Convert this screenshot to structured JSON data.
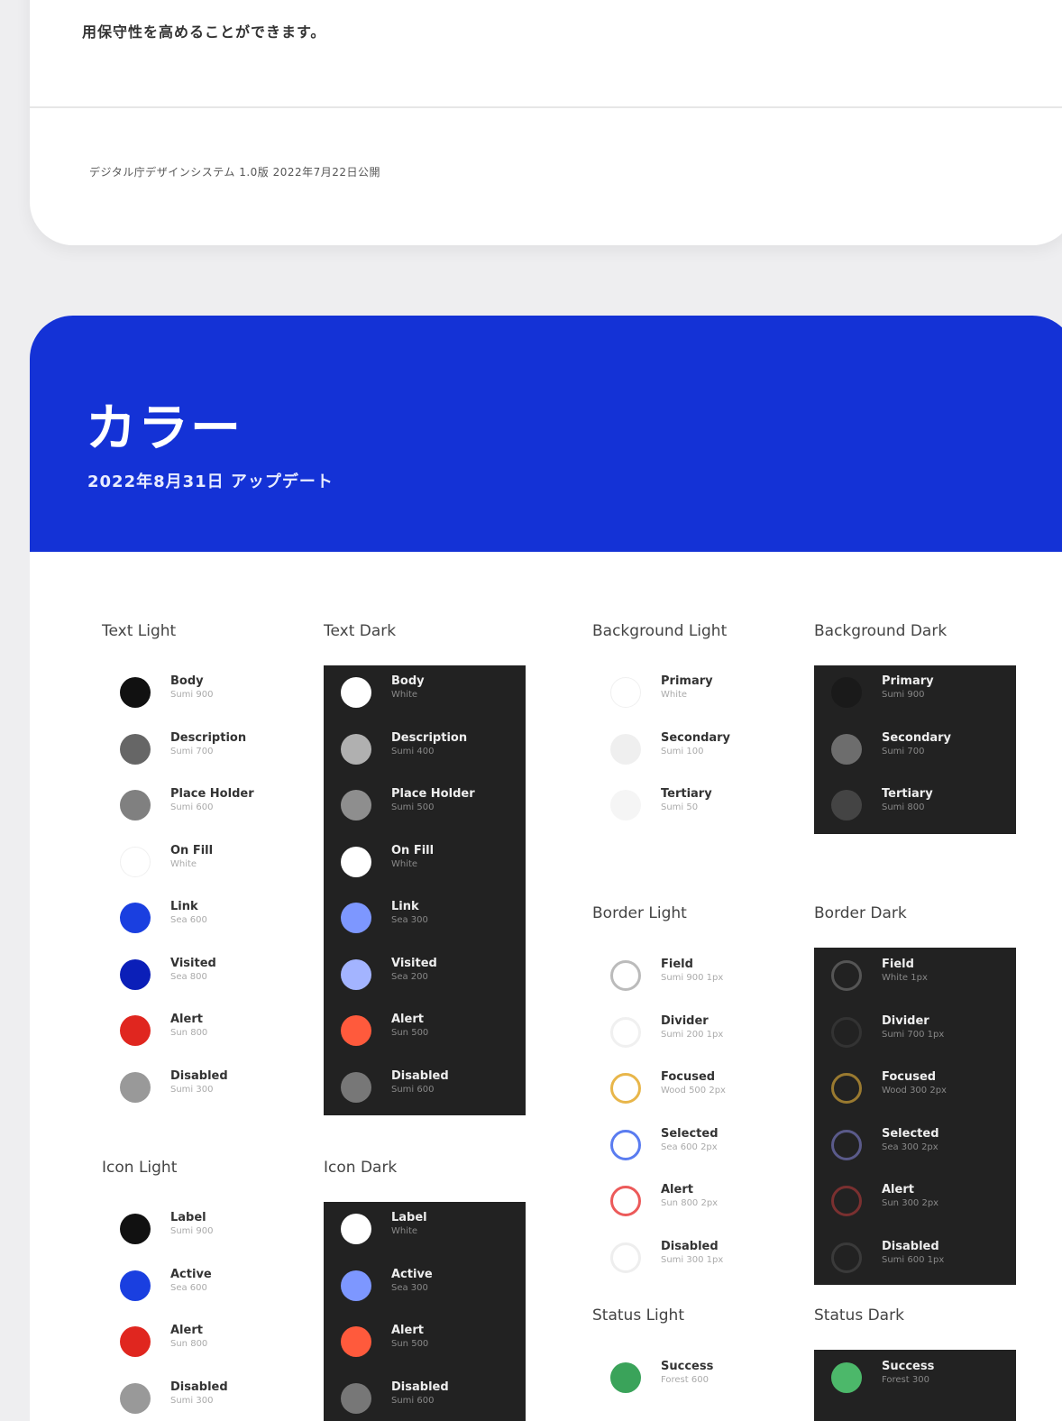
{
  "intro": {
    "text": "用保守性を高めることができます。",
    "footer": "デジタル庁デザインシステム 1.0版 2022年7月22日公開"
  },
  "hero": {
    "title": "カラー",
    "subtitle": "2022年8月31日 アップデート",
    "color": "#1432d6"
  },
  "sections": {
    "text_light": {
      "title": "Text Light",
      "items": [
        {
          "name": "Body",
          "token": "Sumi 900",
          "color": "#111111"
        },
        {
          "name": "Description",
          "token": "Sumi 700",
          "color": "#666666"
        },
        {
          "name": "Place Holder",
          "token": "Sumi 600",
          "color": "#808080"
        },
        {
          "name": "On Fill",
          "token": "White",
          "color": "#ffffff"
        },
        {
          "name": "Link",
          "token": "Sea 600",
          "color": "#1a3fe0"
        },
        {
          "name": "Visited",
          "token": "Sea 800",
          "color": "#0b1fb8"
        },
        {
          "name": "Alert",
          "token": "Sun 800",
          "color": "#e0261f"
        },
        {
          "name": "Disabled",
          "token": "Sumi 300",
          "color": "#999999"
        }
      ]
    },
    "text_dark": {
      "title": "Text Dark",
      "items": [
        {
          "name": "Body",
          "token": "White",
          "color": "#ffffff"
        },
        {
          "name": "Description",
          "token": "Sumi 400",
          "color": "#b0b0b0"
        },
        {
          "name": "Place Holder",
          "token": "Sumi 500",
          "color": "#8e8e8e"
        },
        {
          "name": "On Fill",
          "token": "White",
          "color": "#ffffff"
        },
        {
          "name": "Link",
          "token": "Sea 300",
          "color": "#7d97ff"
        },
        {
          "name": "Visited",
          "token": "Sea 200",
          "color": "#a3b4ff"
        },
        {
          "name": "Alert",
          "token": "Sun 500",
          "color": "#ff5a3c"
        },
        {
          "name": "Disabled",
          "token": "Sumi 600",
          "color": "#777777"
        }
      ]
    },
    "bg_light": {
      "title": "Background Light",
      "items": [
        {
          "name": "Primary",
          "token": "White",
          "color": "#ffffff"
        },
        {
          "name": "Secondary",
          "token": "Sumi 100",
          "color": "#efefef"
        },
        {
          "name": "Tertiary",
          "token": "Sumi 50",
          "color": "#f5f5f5"
        }
      ]
    },
    "bg_dark": {
      "title": "Background Dark",
      "items": [
        {
          "name": "Primary",
          "token": "Sumi 900",
          "color": "#1a1a1a"
        },
        {
          "name": "Secondary",
          "token": "Sumi 700",
          "color": "#6d6d6d"
        },
        {
          "name": "Tertiary",
          "token": "Sumi 800",
          "color": "#444444"
        }
      ]
    },
    "border_light": {
      "title": "Border Light",
      "items": [
        {
          "name": "Field",
          "token": "Sumi 900 1px",
          "color": "#bbbbbb"
        },
        {
          "name": "Divider",
          "token": "Sumi 200 1px",
          "color": "#f0f0f0"
        },
        {
          "name": "Focused",
          "token": "Wood 500 2px",
          "color": "#e8b64a"
        },
        {
          "name": "Selected",
          "token": "Sea 600 2px",
          "color": "#5a7cf0"
        },
        {
          "name": "Alert",
          "token": "Sun 800 2px",
          "color": "#ec5a5a"
        },
        {
          "name": "Disabled",
          "token": "Sumi 300 1px",
          "color": "#eeeeee"
        }
      ]
    },
    "border_dark": {
      "title": "Border Dark",
      "items": [
        {
          "name": "Field",
          "token": "White 1px",
          "color": "#555555"
        },
        {
          "name": "Divider",
          "token": "Sumi 700 1px",
          "color": "#333333"
        },
        {
          "name": "Focused",
          "token": "Wood 300 2px",
          "color": "#9a7a30"
        },
        {
          "name": "Selected",
          "token": "Sea 300 2px",
          "color": "#5a5a8a"
        },
        {
          "name": "Alert",
          "token": "Sun 300 2px",
          "color": "#7a3030"
        },
        {
          "name": "Disabled",
          "token": "Sumi 600 1px",
          "color": "#3a3a3a"
        }
      ]
    },
    "icon_light": {
      "title": "Icon Light",
      "items": [
        {
          "name": "Label",
          "token": "Sumi 900",
          "color": "#111111"
        },
        {
          "name": "Active",
          "token": "Sea 600",
          "color": "#1a3fe0"
        },
        {
          "name": "Alert",
          "token": "Sun 800",
          "color": "#e0261f"
        },
        {
          "name": "Disabled",
          "token": "Sumi 300",
          "color": "#999999"
        }
      ]
    },
    "icon_dark": {
      "title": "Icon Dark",
      "items": [
        {
          "name": "Label",
          "token": "White",
          "color": "#ffffff"
        },
        {
          "name": "Active",
          "token": "Sea 300",
          "color": "#7d97ff"
        },
        {
          "name": "Alert",
          "token": "Sun 500",
          "color": "#ff5a3c"
        },
        {
          "name": "Disabled",
          "token": "Sumi 600",
          "color": "#777777"
        }
      ]
    },
    "status_light": {
      "title": "Status Light",
      "items": [
        {
          "name": "Success",
          "token": "Forest 600",
          "color": "#3aa35a"
        }
      ]
    },
    "status_dark": {
      "title": "Status Dark",
      "items": [
        {
          "name": "Success",
          "token": "Forest 300",
          "color": "#4cb86a"
        }
      ]
    }
  }
}
